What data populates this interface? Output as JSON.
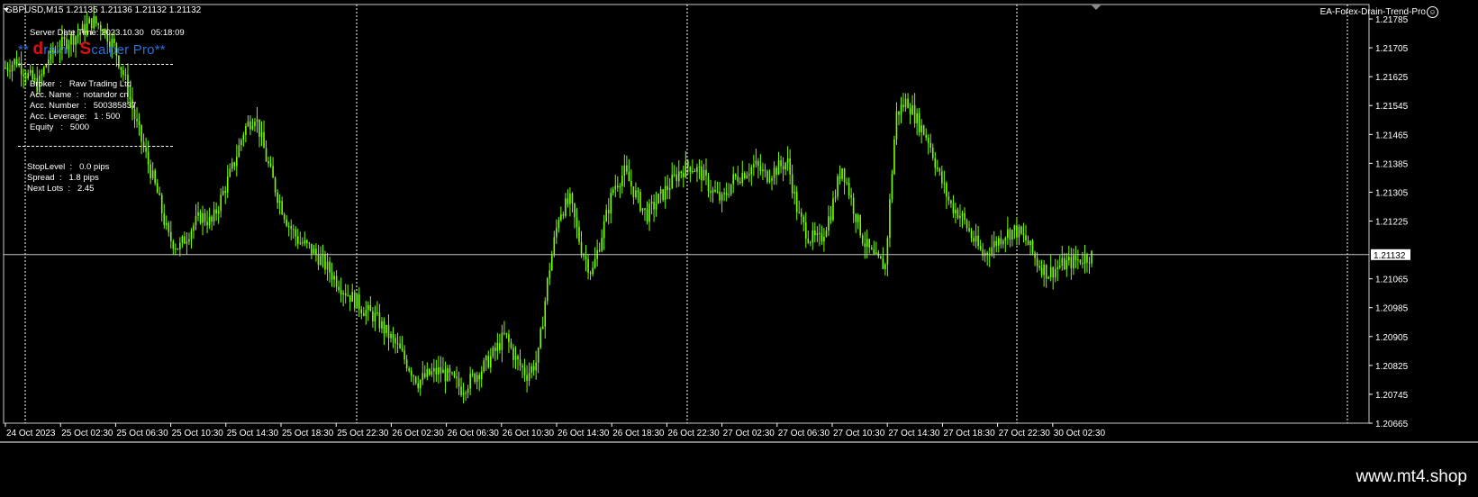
{
  "header": {
    "symbol_info": "GBPUSD,M15  1.21135 1.21136 1.21132 1.21132",
    "ea_name": "EA-Forex-Drain-Trend-Pro",
    "smiley": "☺"
  },
  "overlay": {
    "server_time": "Server Date Time: 2023.10.30   05:18:09",
    "brand": {
      "stars": "**",
      "d": "d",
      "rain": "rain",
      "s": "S",
      "rest": "calper Pro",
      "tail": "**"
    },
    "broker": "Broker  :   Raw Trading Ltd",
    "acc_name": "Acc. Name  :  notandor cn",
    "acc_number": "Acc. Number  :   500385837",
    "acc_leverage": "Acc. Leverage:   1 : 500",
    "equity": "Equity   :   5000",
    "stop_level": "StopLevel  :   0.0 pips",
    "spread": "Spread  :   1.8 pips",
    "next_lots": "Next Lots  :   2.45"
  },
  "price_scale": {
    "ticks": [
      "1.21785",
      "1.21705",
      "1.21625",
      "1.21545",
      "1.21465",
      "1.21385",
      "1.21305",
      "1.21225",
      "1.21065",
      "1.20985",
      "1.20905",
      "1.20825",
      "1.20745",
      "1.20665"
    ],
    "current_price": "1.21132"
  },
  "time_axis": [
    "24 Oct 2023",
    "25 Oct 02:30",
    "25 Oct 06:30",
    "25 Oct 10:30",
    "25 Oct 14:30",
    "25 Oct 18:30",
    "25 Oct 22:30",
    "26 Oct 02:30",
    "26 Oct 06:30",
    "26 Oct 10:30",
    "26 Oct 14:30",
    "26 Oct 18:30",
    "26 Oct 22:30",
    "27 Oct 02:30",
    "27 Oct 06:30",
    "27 Oct 10:30",
    "27 Oct 14:30",
    "27 Oct 18:30",
    "27 Oct 22:30",
    "30 Oct 02:30"
  ],
  "watermark": "www.mt4.shop",
  "colors": {
    "candle": "#7CFC00",
    "background": "#000000",
    "text": "#ffffff",
    "brand_red": "#e01010",
    "brand_blue": "#2a6fdb"
  },
  "chart_data": {
    "type": "line",
    "title": "GBPUSD,M15",
    "ylim": [
      1.20665,
      1.21825
    ],
    "series": [
      {
        "name": "GBPUSD",
        "values": [
          1.2165,
          1.2167,
          1.2163,
          1.216,
          1.2168,
          1.2171,
          1.2173,
          1.2175,
          1.2178,
          1.2176,
          1.2171,
          1.2162,
          1.215,
          1.214,
          1.213,
          1.2118,
          1.2115,
          1.212,
          1.2124,
          1.2122,
          1.213,
          1.2138,
          1.2148,
          1.2152,
          1.214,
          1.213,
          1.2122,
          1.2117,
          1.2115,
          1.2112,
          1.2108,
          1.2104,
          1.2101,
          1.2098,
          1.2096,
          1.2092,
          1.2088,
          1.2083,
          1.2078,
          1.208,
          1.2081,
          1.2079,
          1.2076,
          1.2079,
          1.2082,
          1.2086,
          1.2091,
          1.2084,
          1.208,
          1.2084,
          1.2108,
          1.2125,
          1.2128,
          1.2115,
          1.2108,
          1.212,
          1.2132,
          1.2136,
          1.213,
          1.2124,
          1.2128,
          1.2132,
          1.2136,
          1.2138,
          1.2136,
          1.2131,
          1.2128,
          1.2134,
          1.2136,
          1.2138,
          1.2135,
          1.2137,
          1.2139,
          1.2124,
          1.2118,
          1.2117,
          1.2125,
          1.2138,
          1.2127,
          1.2117,
          1.2112,
          1.211,
          1.2152,
          1.2156,
          1.215,
          1.2145,
          1.2135,
          1.2127,
          1.2124,
          1.2118,
          1.2113,
          1.2116,
          1.2119,
          1.212,
          1.2117,
          1.2111,
          1.2108,
          1.211,
          1.2111,
          1.2112,
          1.2113
        ]
      }
    ]
  }
}
